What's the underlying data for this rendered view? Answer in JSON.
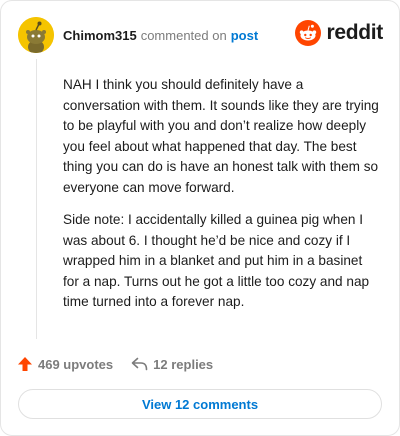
{
  "comment": {
    "username": "Chimom315",
    "action_text": "commented on",
    "post_link": "post",
    "avatar_icon": "snoo-avatar-icon",
    "paragraphs": [
      "NAH I think you should definitely have a conversation with them. It sounds like they are trying to be playful with you and don’t realize how deeply you feel about what happened that day. The best thing you can do is have an honest talk with them so everyone can move forward.",
      "Side note: I accidentally killed a guinea pig when I was about 6. I thought he’d be nice and cozy if I wrapped him in a blanket and put him in a basinet for a nap. Turns out he got a little too cozy and nap time turned into a forever nap."
    ]
  },
  "brand": {
    "name": "reddit",
    "icon": "reddit-logo-icon",
    "accent": "#ff4500"
  },
  "actions": {
    "upvotes": "469 upvotes",
    "upvote_icon": "upvote-arrow-icon",
    "replies": "12 replies",
    "reply_icon": "reply-icon"
  },
  "view_button": {
    "label": "View 12 comments"
  },
  "colors": {
    "link": "#0079d3",
    "avatar_bg": "#f5c400",
    "muted_text": "#7c7c7c"
  }
}
